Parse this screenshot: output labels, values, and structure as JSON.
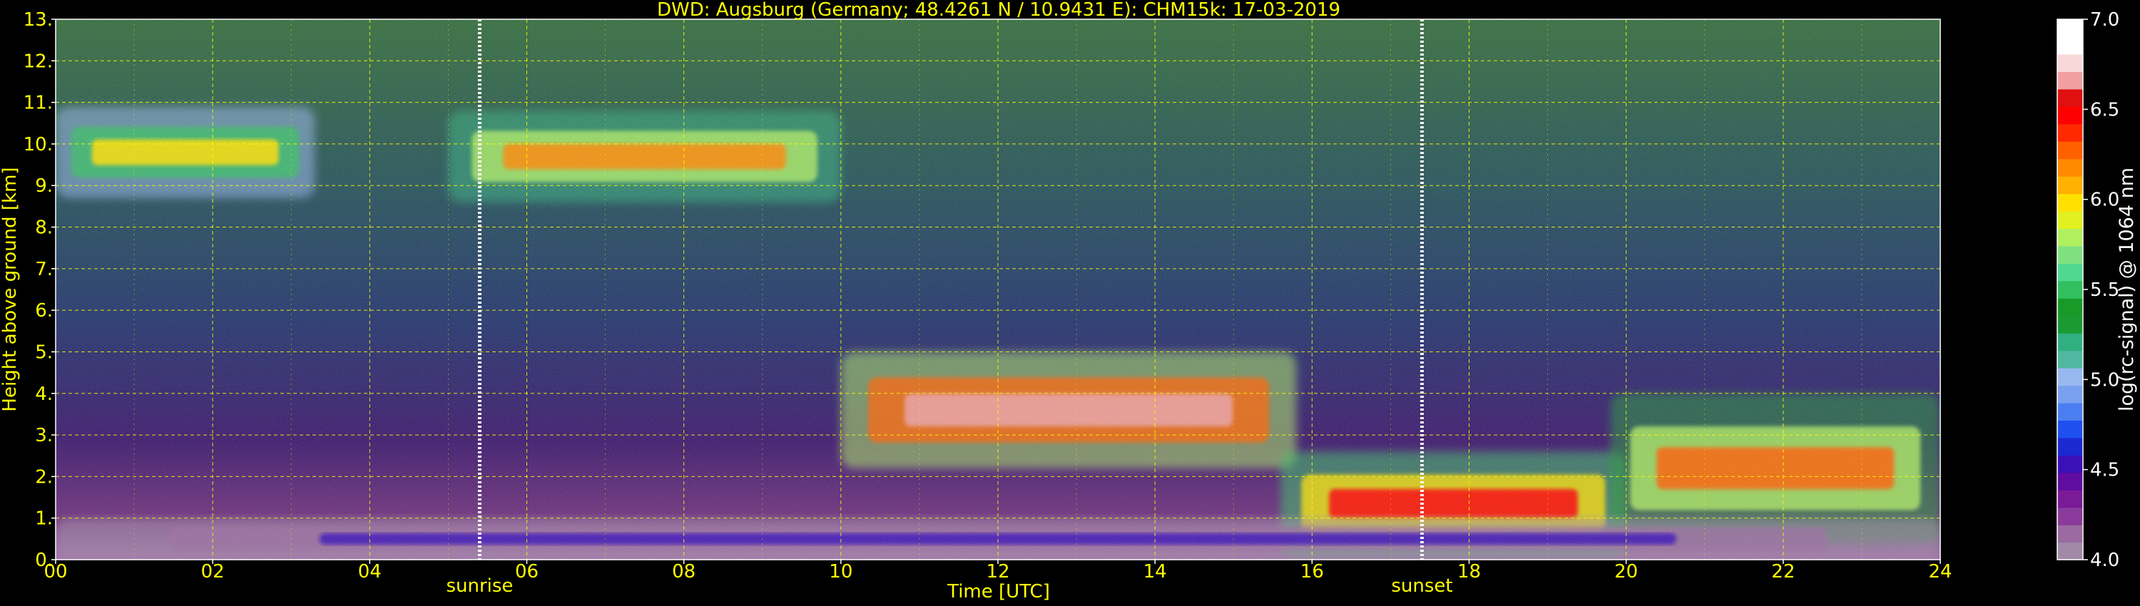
{
  "chart_data": {
    "type": "heatmap",
    "title": "DWD: Augsburg (Germany; 48.4261 N / 10.9431 E):    CHM15k: 17-03-2019",
    "xlabel": "Time [UTC]",
    "ylabel": "Height above ground [km]",
    "x_ticks": [
      "00",
      "02",
      "04",
      "06",
      "08",
      "10",
      "12",
      "14",
      "16",
      "18",
      "20",
      "22",
      "24"
    ],
    "x_tick_values": [
      0,
      2,
      4,
      6,
      8,
      10,
      12,
      14,
      16,
      18,
      20,
      22,
      24
    ],
    "y_ticks": [
      "0.",
      "1.",
      "2.",
      "3.",
      "4.",
      "5.",
      "6.",
      "7.",
      "8.",
      "9.",
      "10.",
      "11.",
      "12.",
      "13."
    ],
    "y_tick_values": [
      0,
      1,
      2,
      3,
      4,
      5,
      6,
      7,
      8,
      9,
      10,
      11,
      12,
      13
    ],
    "xlim": [
      0,
      24
    ],
    "ylim": [
      0,
      13
    ],
    "grid": true,
    "annotations": [
      {
        "text": "sunrise",
        "x": 5.4
      },
      {
        "text": "sunset",
        "x": 17.4
      }
    ],
    "colorbar": {
      "label": "log(rc-signal) @ 1064 nm",
      "ticks": [
        "4.0",
        "4.5",
        "5.0",
        "5.5",
        "6.0",
        "6.5",
        "7.0"
      ],
      "tick_values": [
        4.0,
        4.5,
        5.0,
        5.5,
        6.0,
        6.5,
        7.0
      ],
      "range": [
        4.0,
        7.0
      ]
    },
    "features": [
      {
        "name": "cirrus-early",
        "x_start": 0.0,
        "x_end": 3.3,
        "y_bottom": 8.7,
        "y_top": 10.9,
        "value": 6.0
      },
      {
        "name": "cirrus-morning",
        "x_start": 5.0,
        "x_end": 10.0,
        "y_bottom": 8.6,
        "y_top": 10.8,
        "value": 6.2
      },
      {
        "name": "cloud-midday",
        "x_start": 10.0,
        "x_end": 15.8,
        "y_bottom": 2.2,
        "y_top": 5.0,
        "value": 6.8
      },
      {
        "name": "low-cloud-evening",
        "x_start": 15.6,
        "x_end": 20.0,
        "y_bottom": 0.1,
        "y_top": 2.6,
        "value": 6.5
      },
      {
        "name": "cloud-night",
        "x_start": 19.8,
        "x_end": 24.0,
        "y_bottom": 0.4,
        "y_top": 4.0,
        "value": 6.3
      },
      {
        "name": "boundary-layer",
        "x_start": 0.0,
        "x_end": 24.0,
        "y_bottom": 0.0,
        "y_top": 1.0,
        "value": 4.6
      }
    ]
  },
  "colors": {
    "text": "#ffff00",
    "grid": "#ffff00",
    "vline": "#ffffff",
    "colorbar_label": "#ffffff"
  }
}
